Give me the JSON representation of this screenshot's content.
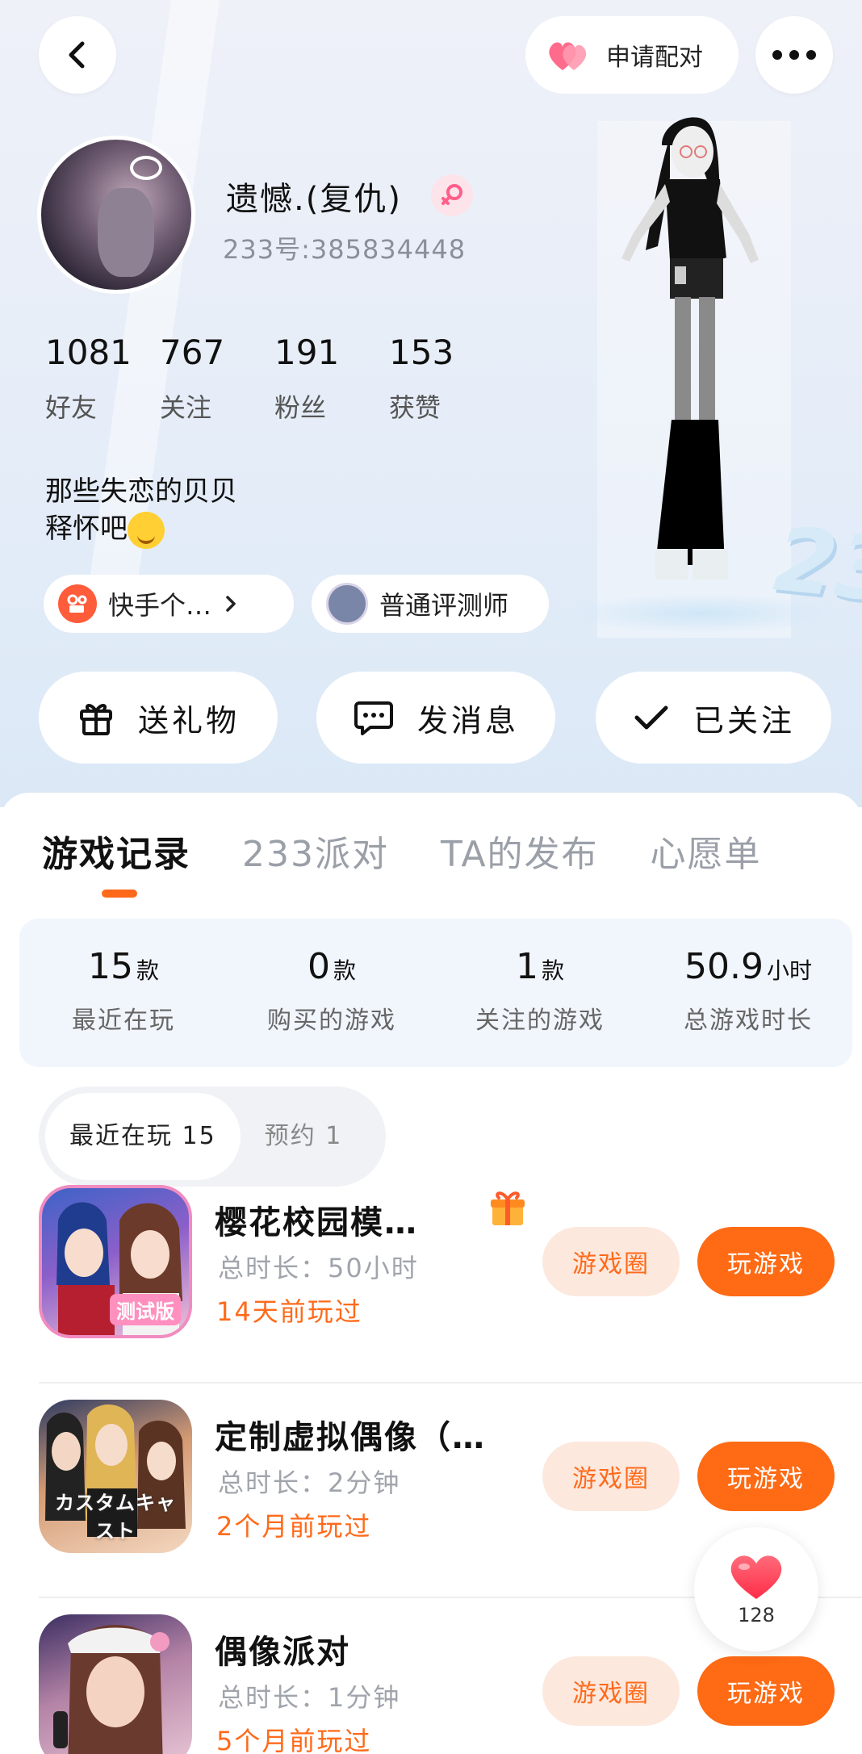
{
  "header": {
    "pair_label": "申请配对"
  },
  "profile": {
    "nickname": "遗憾.(复仇)",
    "uid": "233号:385834448",
    "stats": [
      {
        "value": "1081",
        "label": "好友"
      },
      {
        "value": "767",
        "label": "关注"
      },
      {
        "value": "191",
        "label": "粉丝"
      },
      {
        "value": "153",
        "label": "获赞"
      }
    ],
    "bio_line1": "那些失恋的贝贝",
    "bio_line2": "释怀吧",
    "tags": {
      "kuaishou": "快手个…",
      "reviewer": "普通评测师"
    }
  },
  "actions": {
    "gift": "送礼物",
    "message": "发消息",
    "followed": "已关注"
  },
  "tabs": [
    {
      "label": "游戏记录",
      "active": true
    },
    {
      "label": "233派对",
      "active": false
    },
    {
      "label": "TA的发布",
      "active": false
    },
    {
      "label": "心愿单",
      "active": false
    }
  ],
  "summary": [
    {
      "value": "15",
      "unit": "款",
      "caption": "最近在玩"
    },
    {
      "value": "0",
      "unit": "款",
      "caption": "购买的游戏"
    },
    {
      "value": "1",
      "unit": "款",
      "caption": "关注的游戏"
    },
    {
      "value": "50.9",
      "unit": "小时",
      "caption": "总游戏时长"
    }
  ],
  "segments": {
    "recent": "最近在玩 15",
    "reserve": "预约 1"
  },
  "games": [
    {
      "title": "樱花校园模…",
      "total": "总时长：50小时",
      "last": "14天前玩过",
      "icon_tag": "测试版",
      "circle": "游戏圈",
      "play": "玩游戏"
    },
    {
      "title": "定制虚拟偶像（…",
      "total": "总时长：2分钟",
      "last": "2个月前玩过",
      "icon_tag": "カスタムキャスト",
      "circle": "游戏圈",
      "play": "玩游戏"
    },
    {
      "title": "偶像派对",
      "total": "总时长：1分钟",
      "last": "5个月前玩过",
      "icon_tag": "",
      "circle": "游戏圈",
      "play": "玩游戏"
    }
  ],
  "like": {
    "count": "128"
  },
  "colors": {
    "accent": "#ff6a14",
    "accent_soft": "#fde8de",
    "heart": "#ff4d5e"
  }
}
